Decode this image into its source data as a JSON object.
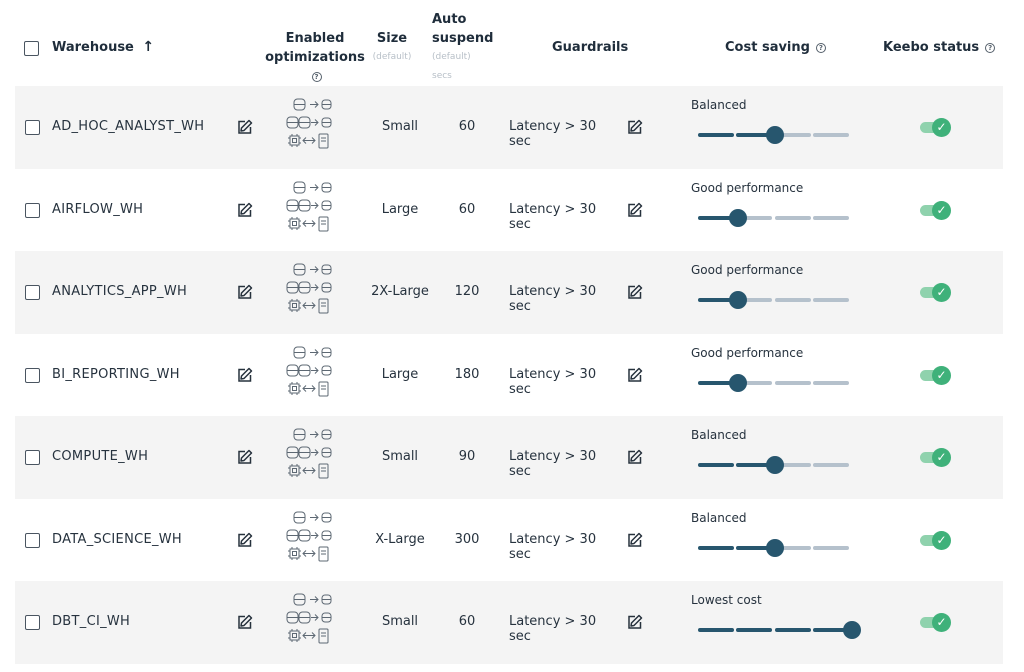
{
  "header": {
    "warehouse": "Warehouse",
    "sort_arrow": "↑",
    "enabled_line1": "Enabled",
    "enabled_line2": "optimizations",
    "size": "Size",
    "size_sub": "(default)",
    "auto_line1": "Auto",
    "auto_line2": "suspend",
    "auto_sub1": "(default)",
    "auto_sub2": "secs",
    "guardrails": "Guardrails",
    "cost_saving": "Cost saving",
    "keebo_status": "Keebo status",
    "help_glyph": "?"
  },
  "icons": {
    "edit": "edit-icon",
    "optimizations": "optimizations-icons",
    "help": "help-circle-icon",
    "check": "✓"
  },
  "colors": {
    "slider_active": "#27566e",
    "slider_inactive": "#b5c1cc",
    "toggle_on": "#3fb17a",
    "row_shade": "#f4f4f4"
  },
  "rows": [
    {
      "name": "AD_HOC_ANALYST_WH",
      "size": "Small",
      "auto_suspend": "60",
      "guardrail": "Latency > 30 sec",
      "cost_label": "Balanced",
      "cost_level": 3,
      "keebo_enabled": true
    },
    {
      "name": "AIRFLOW_WH",
      "size": "Large",
      "auto_suspend": "60",
      "guardrail": "Latency > 30 sec",
      "cost_label": "Good performance",
      "cost_level": 2,
      "keebo_enabled": true
    },
    {
      "name": "ANALYTICS_APP_WH",
      "size": "2X-Large",
      "auto_suspend": "120",
      "guardrail": "Latency > 30 sec",
      "cost_label": "Good performance",
      "cost_level": 2,
      "keebo_enabled": true
    },
    {
      "name": "BI_REPORTING_WH",
      "size": "Large",
      "auto_suspend": "180",
      "guardrail": "Latency > 30 sec",
      "cost_label": "Good performance",
      "cost_level": 2,
      "keebo_enabled": true
    },
    {
      "name": "COMPUTE_WH",
      "size": "Small",
      "auto_suspend": "90",
      "guardrail": "Latency > 30 sec",
      "cost_label": "Balanced",
      "cost_level": 3,
      "keebo_enabled": true
    },
    {
      "name": "DATA_SCIENCE_WH",
      "size": "X-Large",
      "auto_suspend": "300",
      "guardrail": "Latency > 30 sec",
      "cost_label": "Balanced",
      "cost_level": 3,
      "keebo_enabled": true
    },
    {
      "name": "DBT_CI_WH",
      "size": "Small",
      "auto_suspend": "60",
      "guardrail": "Latency > 30 sec",
      "cost_label": "Lowest cost",
      "cost_level": 5,
      "keebo_enabled": true
    }
  ]
}
